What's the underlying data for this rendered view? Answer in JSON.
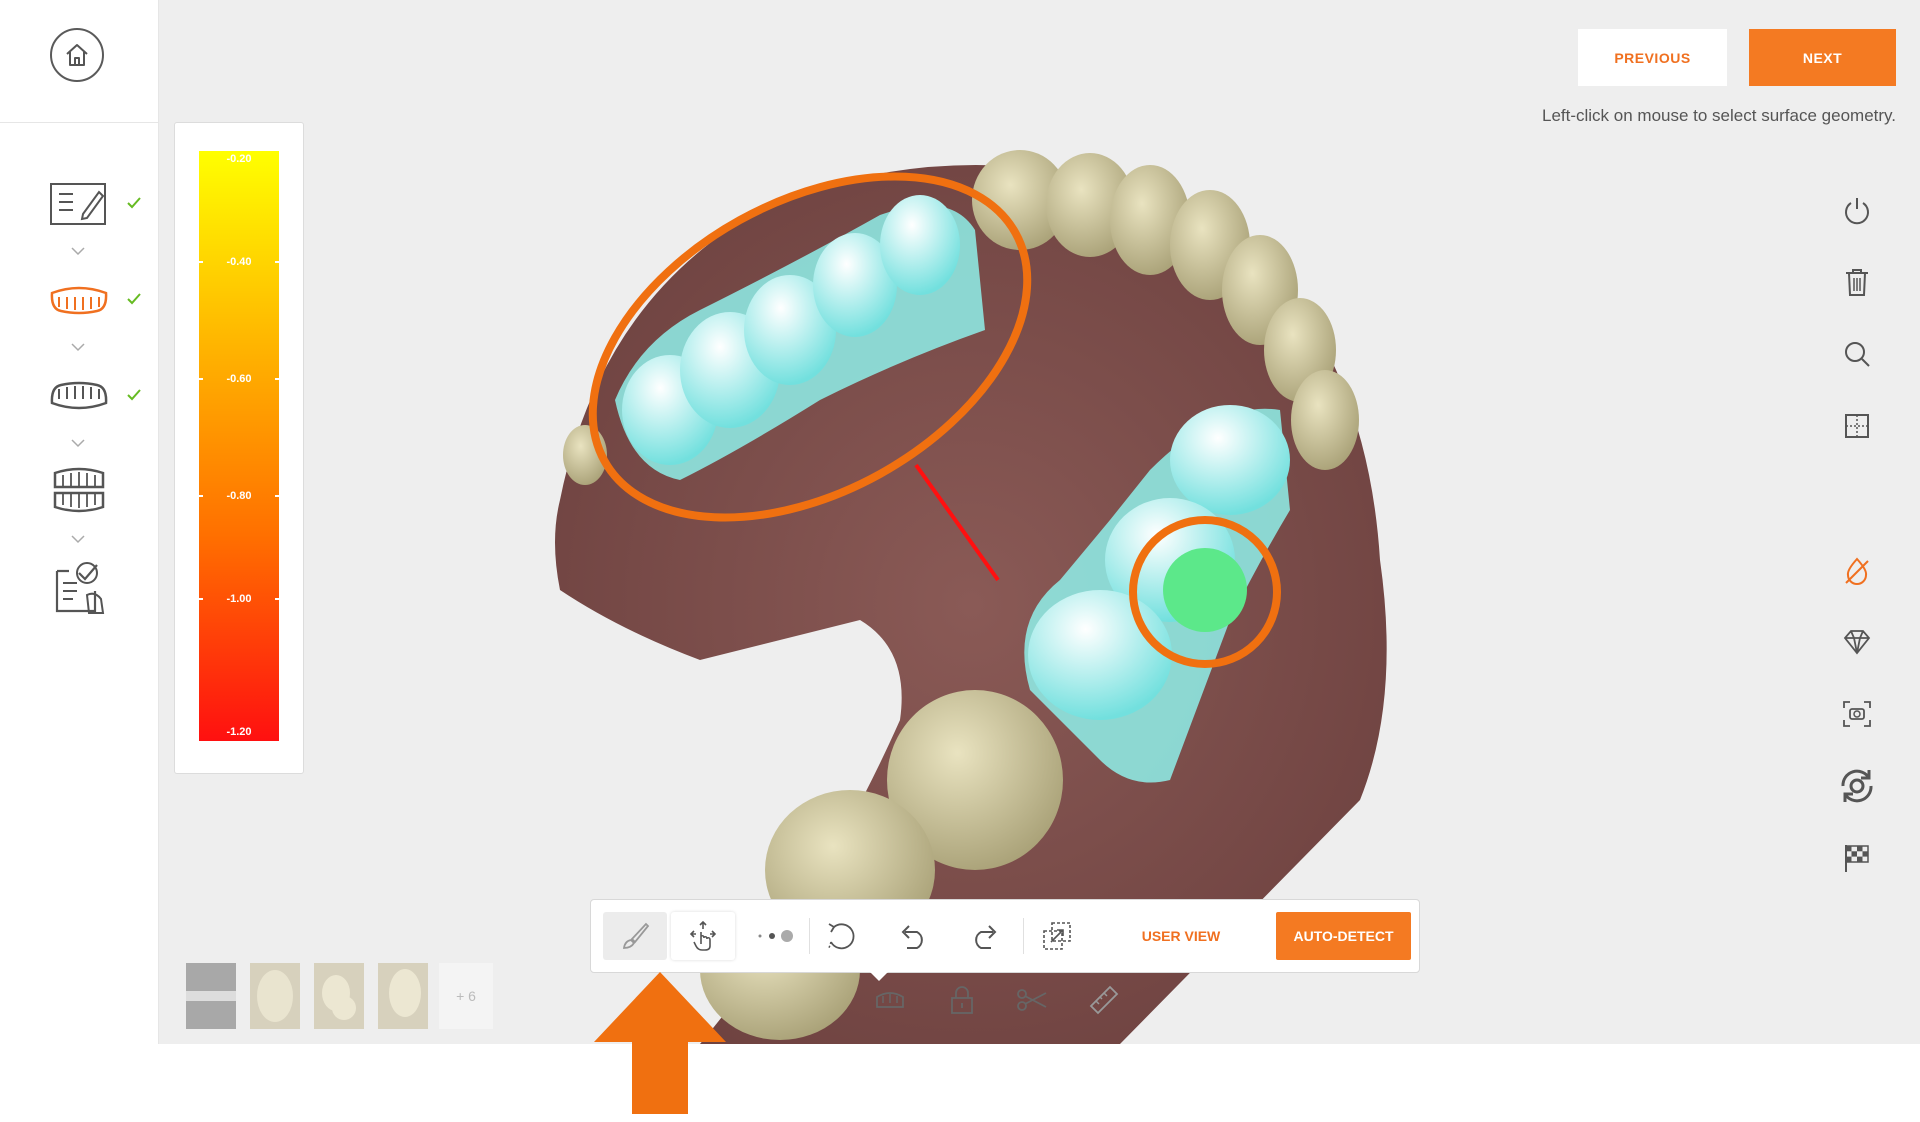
{
  "header": {
    "previous_label": "PREVIOUS",
    "next_label": "NEXT",
    "hint": "Left-click on mouse  to select surface geometry."
  },
  "sidebar": {
    "home_icon": "home-icon",
    "steps": [
      {
        "icon": "form-edit-icon",
        "completed": true
      },
      {
        "icon": "upper-jaw-icon",
        "completed": true,
        "active": true
      },
      {
        "icon": "lower-jaw-icon",
        "completed": true
      },
      {
        "icon": "bite-icon",
        "completed": false
      },
      {
        "icon": "review-checklist-icon",
        "completed": false
      }
    ]
  },
  "legend": {
    "labels": [
      "-0.20",
      "-0.40",
      "-0.60",
      "-0.80",
      "-1.00",
      "-1.20"
    ],
    "min": -1.2,
    "max": -0.2
  },
  "right_tools": [
    "power-icon",
    "trash-icon",
    "search-icon",
    "crop-icon",
    "no-color-icon",
    "gem-icon",
    "camera-capture-icon",
    "rotate-settings-icon",
    "checkered-flag-icon"
  ],
  "toolbar": {
    "tools": [
      "brush-icon",
      "touch-move-icon",
      "dot-size-icon",
      "lasso-icon",
      "undo-icon",
      "redo-icon",
      "select-area-icon"
    ],
    "user_view_label": "USER VIEW",
    "auto_detect_label": "AUTO-DETECT"
  },
  "sub_tools": [
    "jaw-tray-icon",
    "lock-icon",
    "scissors-icon",
    "ruler-icon"
  ],
  "thumbnails": {
    "more_label": "+ 6"
  },
  "colors": {
    "accent": "#f47a22",
    "check": "#66bb22",
    "selection_cyan": "#8ef0f0",
    "annotation_orange": "#f07010",
    "annotation_red": "#ff1010"
  }
}
